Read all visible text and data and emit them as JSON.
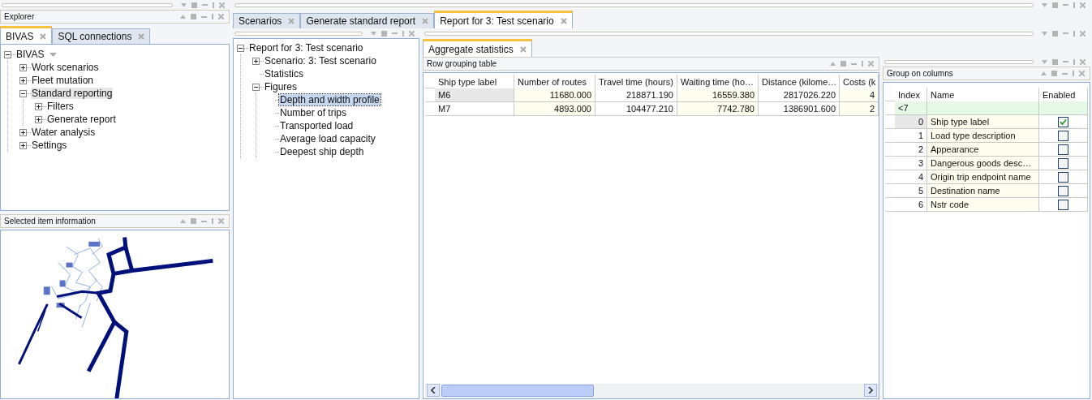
{
  "explorer": {
    "title": "Explorer",
    "tabs": [
      {
        "label": "BIVAS",
        "selected": true
      },
      {
        "label": "SQL connections",
        "selected": false
      }
    ],
    "tree": [
      {
        "label": "BIVAS",
        "expanded": true,
        "selected": false,
        "children": [
          {
            "label": "Work scenarios",
            "expanded": false,
            "selected": false
          },
          {
            "label": "Fleet mutation",
            "expanded": false,
            "selected": false
          },
          {
            "label": "Standard reporting",
            "expanded": true,
            "selected": true,
            "children": [
              {
                "label": "Filters",
                "expanded": false,
                "selected": false
              },
              {
                "label": "Generate report",
                "expanded": false,
                "selected": false
              }
            ]
          },
          {
            "label": "Water analysis",
            "expanded": false,
            "selected": false
          },
          {
            "label": "Settings",
            "expanded": false,
            "selected": false
          }
        ]
      }
    ]
  },
  "selected_item_panel": {
    "title": "Selected item information"
  },
  "document_tabs": [
    {
      "label": "Scenarios",
      "selected": false
    },
    {
      "label": "Generate standard report",
      "selected": false
    },
    {
      "label": "Report for 3: Test scenario",
      "selected": true
    }
  ],
  "report_tree": [
    {
      "label": "Report for 3: Test scenario",
      "expanded": true,
      "selected": false,
      "children": [
        {
          "label": "Scenario: 3: Test scenario",
          "expanded": false,
          "selected": false
        },
        {
          "label": "Statistics",
          "selected": false
        },
        {
          "label": "Figures",
          "expanded": true,
          "selected": false,
          "children": [
            {
              "label": "Depth and width profile",
              "selected": true
            },
            {
              "label": "Number of trips",
              "selected": false
            },
            {
              "label": "Transported load",
              "selected": false
            },
            {
              "label": "Average load capacity",
              "selected": false
            },
            {
              "label": "Deepest ship depth",
              "selected": false
            }
          ]
        }
      ]
    }
  ],
  "result_tabs": [
    {
      "label": "Aggregate statistics",
      "selected": true
    }
  ],
  "row_grouping_table": {
    "title": "Row grouping table",
    "columns": [
      "Ship type label",
      "Number of routes",
      "Travel time (hours)",
      "Waiting time (ho…",
      "Distance (kilome…",
      "Costs (k"
    ],
    "rows": [
      {
        "selected": true,
        "cells": [
          "M6",
          "11680.000",
          "218871.190",
          "16559.380",
          "2817026.220",
          "4"
        ]
      },
      {
        "selected": false,
        "cells": [
          "M7",
          "4893.000",
          "104477.210",
          "7742.780",
          "1386901.600",
          "2"
        ]
      }
    ]
  },
  "group_on_columns": {
    "title": "Group on columns",
    "columns": [
      "Index",
      "Name",
      "Enabled"
    ],
    "filter": "<7",
    "rows": [
      {
        "index": "0",
        "name": "Ship type label",
        "enabled": true,
        "selected": true
      },
      {
        "index": "1",
        "name": "Load type description",
        "enabled": false,
        "selected": false
      },
      {
        "index": "2",
        "name": "Appearance",
        "enabled": false,
        "selected": false
      },
      {
        "index": "3",
        "name": "Dangerous goods desc…",
        "enabled": false,
        "selected": false
      },
      {
        "index": "4",
        "name": "Origin trip endpoint name",
        "enabled": false,
        "selected": false
      },
      {
        "index": "5",
        "name": "Destination name",
        "enabled": false,
        "selected": false
      },
      {
        "index": "6",
        "name": "Nstr code",
        "enabled": false,
        "selected": false
      }
    ]
  }
}
